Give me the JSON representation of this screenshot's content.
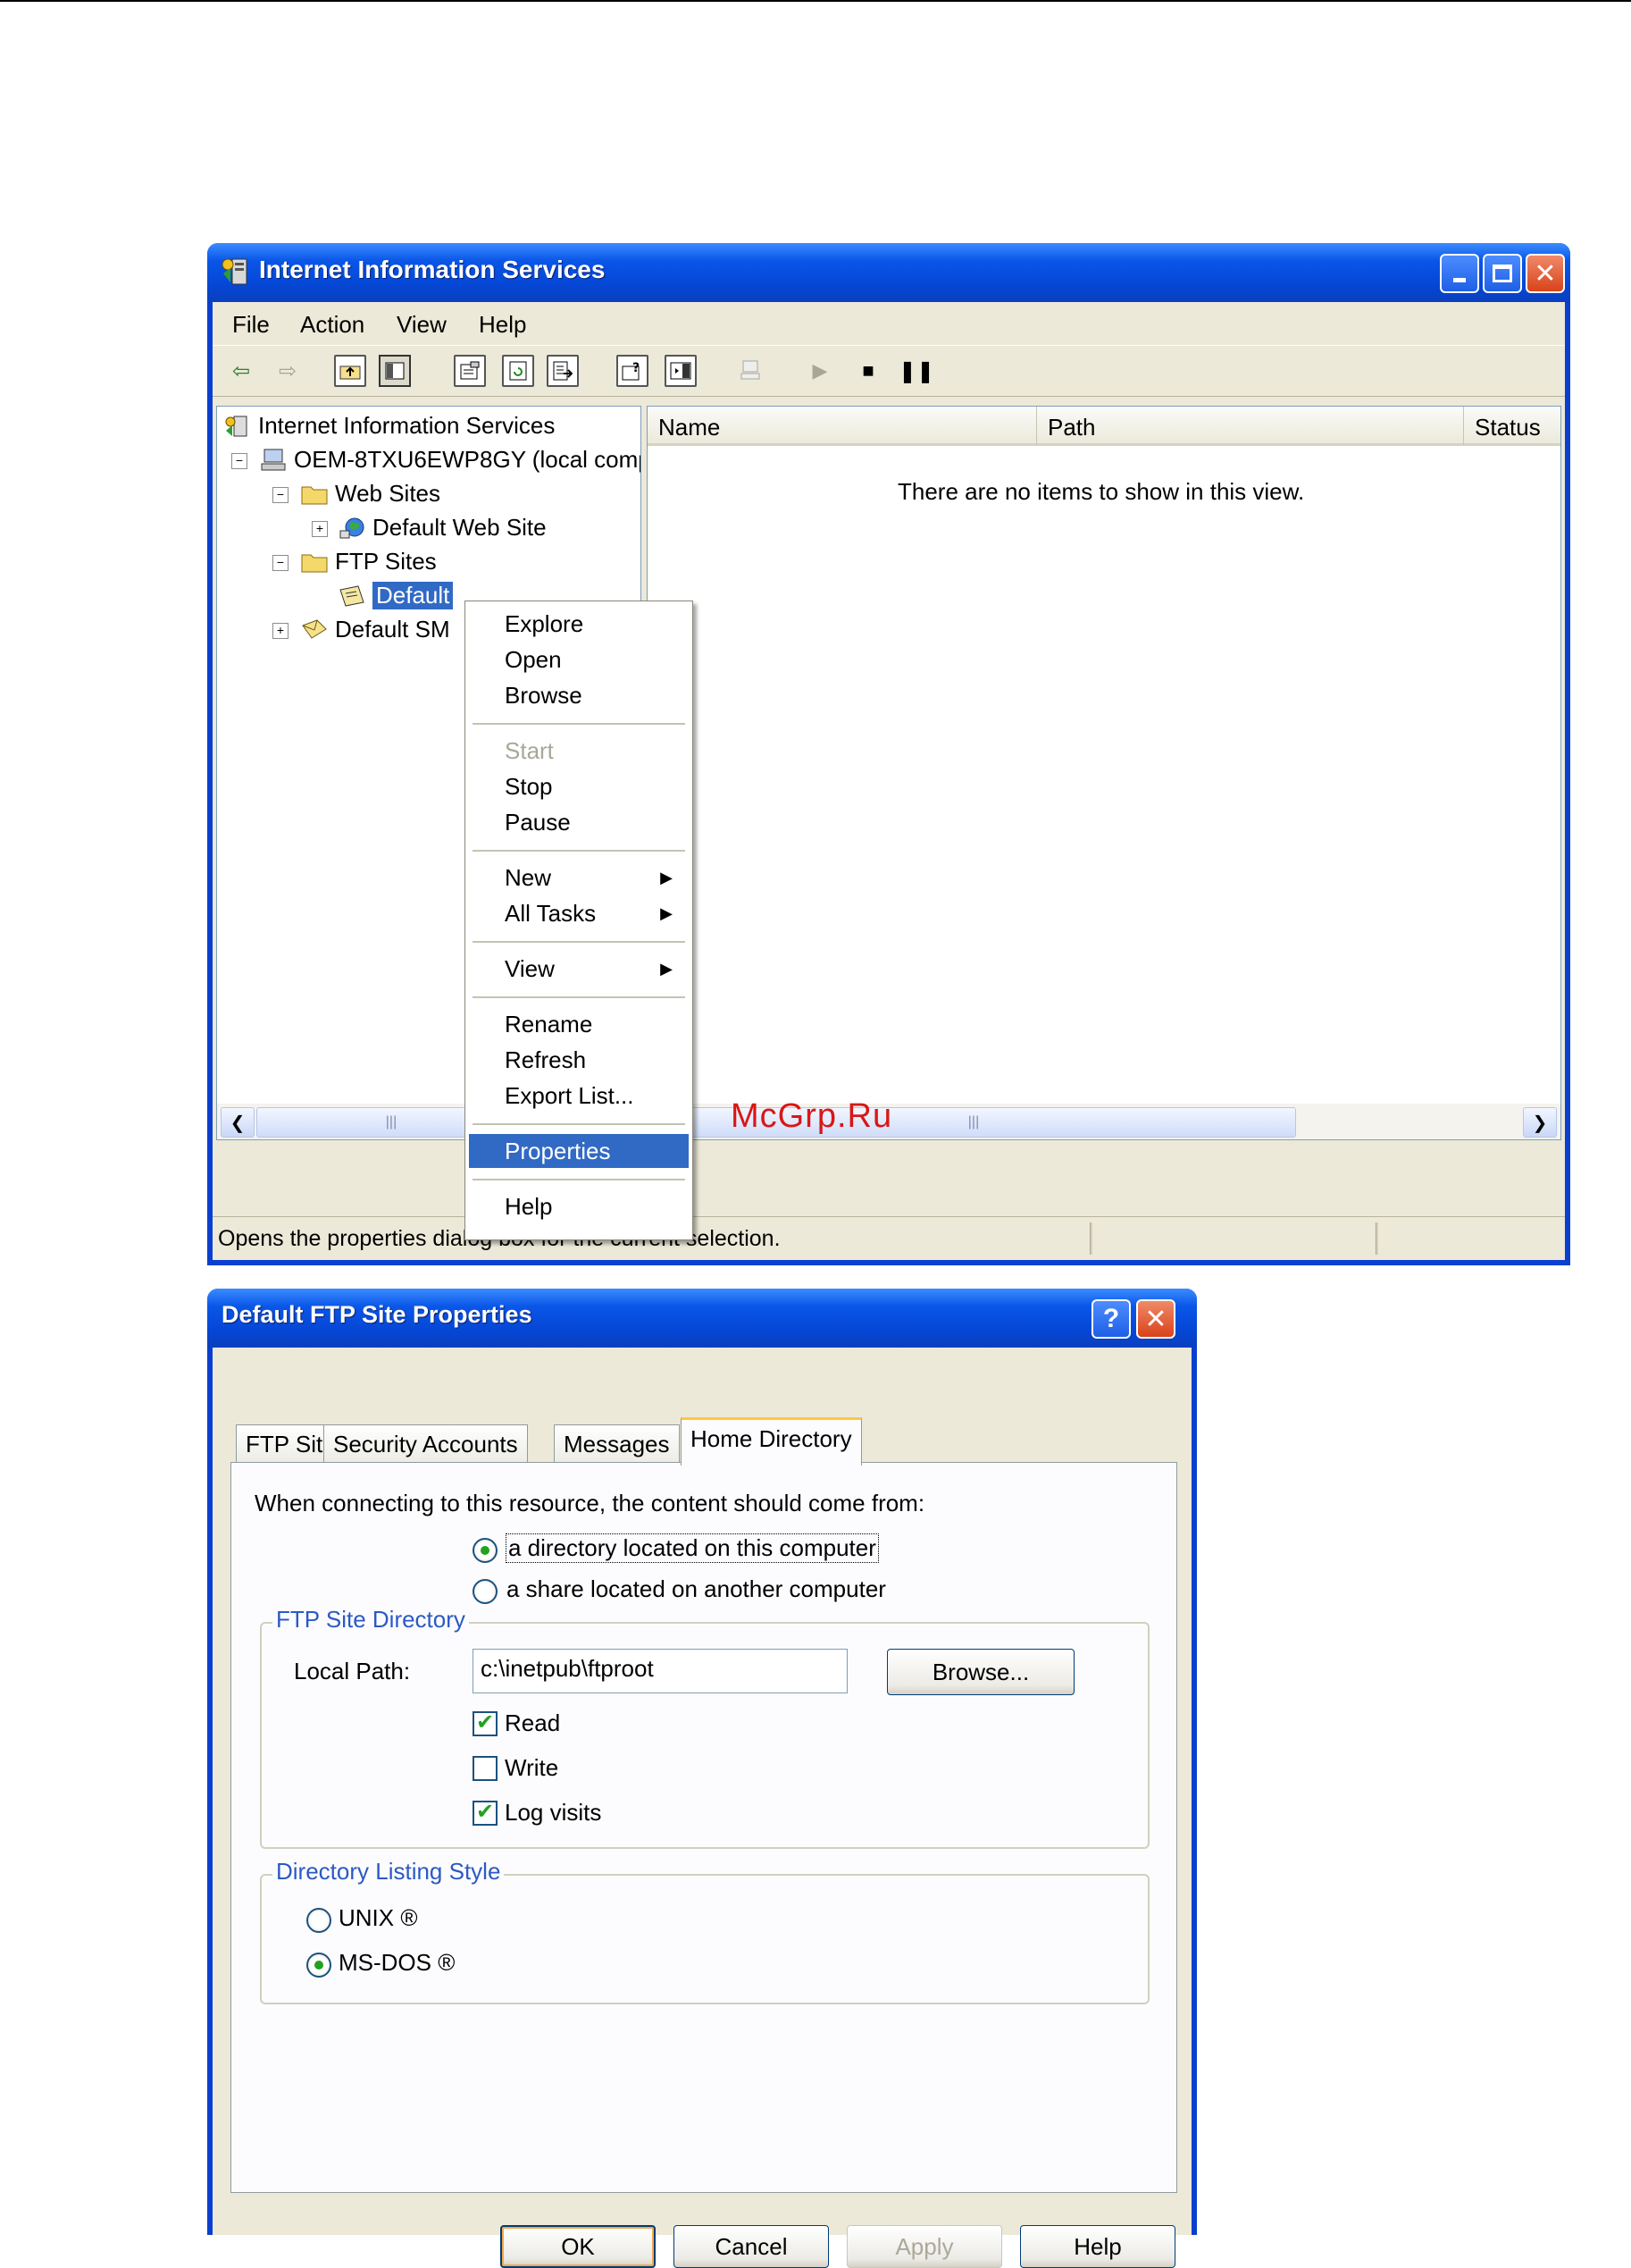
{
  "iis_window": {
    "title": "Internet Information Services",
    "menu": [
      "File",
      "Action",
      "View",
      "Help"
    ],
    "tree": {
      "root": "Internet Information Services",
      "computer": "OEM-8TXU6EWP8GY (local comp",
      "web_sites": "Web Sites",
      "default_web_site": "Default Web Site",
      "ftp_sites": "FTP Sites",
      "default_ftp_site": "Default",
      "default_smtp": "Default SM"
    },
    "list": {
      "columns": [
        "Name",
        "Path",
        "Status"
      ],
      "empty_message": "There are no items to show in this view."
    },
    "status_text": "Opens the properties dialog box for the current selection."
  },
  "context_menu": {
    "items": [
      "Explore",
      "Open",
      "Browse",
      "Start",
      "Stop",
      "Pause",
      "New",
      "All Tasks",
      "View",
      "Rename",
      "Refresh",
      "Export List...",
      "Properties",
      "Help"
    ],
    "disabled": [
      "Start"
    ],
    "highlighted": "Properties"
  },
  "watermark": "McGrp.Ru",
  "properties_dialog": {
    "title": "Default FTP Site Properties",
    "help_glyph": "?",
    "tabs": [
      "FTP Site",
      "Security Accounts",
      "Messages",
      "Home Directory"
    ],
    "active_tab": "Home Directory",
    "source_prompt": "When connecting to this resource, the content should come from:",
    "source_options": [
      {
        "label": "a directory located on this computer",
        "selected": true
      },
      {
        "label": "a share located on another computer",
        "selected": false
      }
    ],
    "ftp_site_directory": {
      "group_title": "FTP Site Directory",
      "local_path_label": "Local Path:",
      "local_path_value": "c:\\inetpub\\ftproot",
      "browse_label": "Browse...",
      "permissions": [
        {
          "label": "Read",
          "checked": true
        },
        {
          "label": "Write",
          "checked": false
        },
        {
          "label": "Log visits",
          "checked": true
        }
      ]
    },
    "listing_style": {
      "group_title": "Directory Listing Style",
      "options": [
        {
          "label": "UNIX ®",
          "selected": false
        },
        {
          "label": "MS-DOS ®",
          "selected": true
        }
      ]
    },
    "buttons": {
      "ok": "OK",
      "cancel": "Cancel",
      "apply": "Apply",
      "help": "Help"
    }
  }
}
